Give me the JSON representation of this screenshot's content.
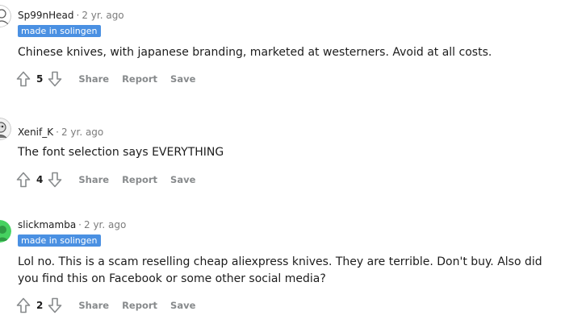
{
  "comments": [
    {
      "author": "Sp99nHead",
      "separator": "·",
      "time": "2 yr. ago",
      "flair": "made in solingen",
      "body": "Chinese knives, with japanese branding, marketed at westerners. Avoid at all costs.",
      "score": "5",
      "share": "Share",
      "report": "Report",
      "save": "Save"
    },
    {
      "author": "Xenif_K",
      "separator": "·",
      "time": "2 yr. ago",
      "flair": "",
      "body": "The font selection says EVERYTHING",
      "score": "4",
      "share": "Share",
      "report": "Report",
      "save": "Save"
    },
    {
      "author": "slickmamba",
      "separator": "·",
      "time": "2 yr. ago",
      "flair": "made in solingen",
      "body": "Lol no. This is a scam reselling cheap aliexpress knives. They are terrible. Don't buy. Also did you find this on Facebook or some other social media?",
      "score": "2",
      "share": "Share",
      "report": "Report",
      "save": "Save"
    }
  ],
  "colors": {
    "flair_bg": "#4a90e2",
    "meta_gray": "#7c7c7c",
    "action_gray": "#878a8c",
    "avatar_green": "#46d160"
  }
}
